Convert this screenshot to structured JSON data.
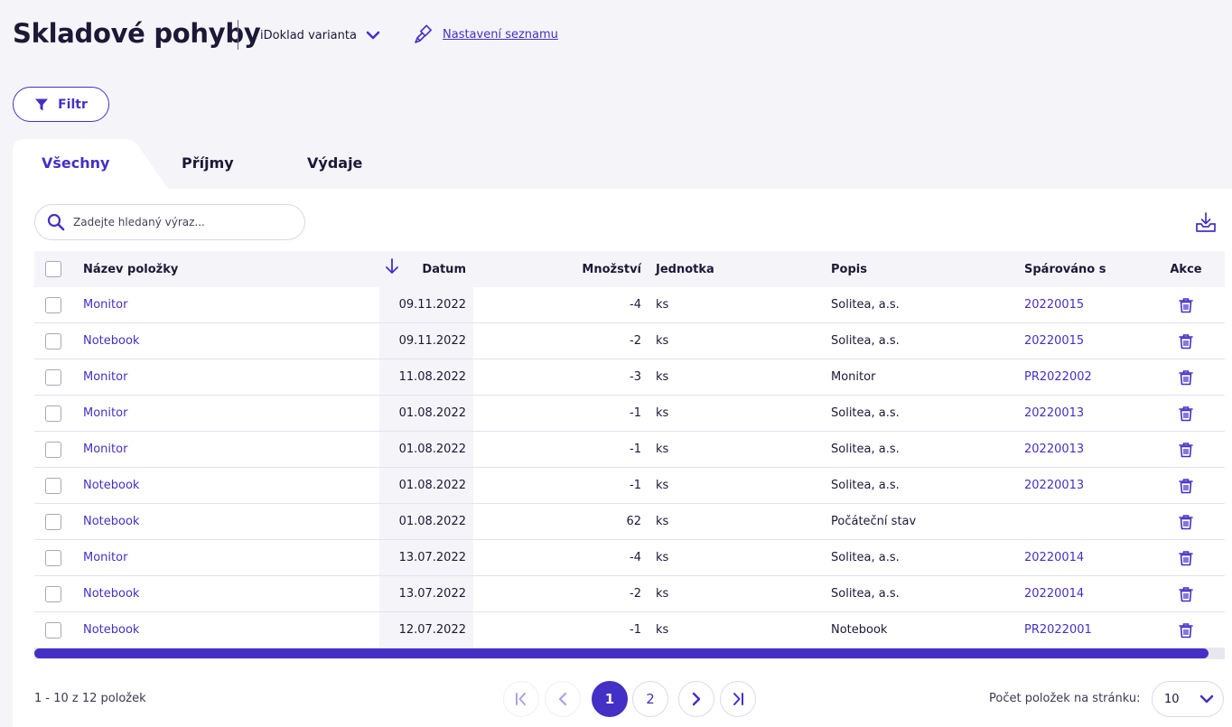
{
  "page": {
    "title": "Skladové pohyby"
  },
  "header": {
    "variant_label": "iDoklad varianta",
    "settings_link": "Nastavení seznamu"
  },
  "toolbar": {
    "filter_label": "Filtr"
  },
  "tabs": [
    {
      "label": "Všechny",
      "active": true
    },
    {
      "label": "Příjmy",
      "active": false
    },
    {
      "label": "Výdaje",
      "active": false
    }
  ],
  "search": {
    "placeholder": "Zadejte hledaný výraz..."
  },
  "table": {
    "columns": {
      "name": "Název položky",
      "date": "Datum",
      "qty": "Množství",
      "unit": "Jednotka",
      "desc": "Popis",
      "paired": "Spárováno s",
      "actions": "Akce"
    },
    "rows": [
      {
        "name": "Monitor",
        "date": "09.11.2022",
        "qty": "-4",
        "unit": "ks",
        "desc": "Solitea, a.s.",
        "paired": "20220015"
      },
      {
        "name": "Notebook",
        "date": "09.11.2022",
        "qty": "-2",
        "unit": "ks",
        "desc": "Solitea, a.s.",
        "paired": "20220015"
      },
      {
        "name": "Monitor",
        "date": "11.08.2022",
        "qty": "-3",
        "unit": "ks",
        "desc": "Monitor",
        "paired": "PR2022002"
      },
      {
        "name": "Monitor",
        "date": "01.08.2022",
        "qty": "-1",
        "unit": "ks",
        "desc": "Solitea, a.s.",
        "paired": "20220013"
      },
      {
        "name": "Monitor",
        "date": "01.08.2022",
        "qty": "-1",
        "unit": "ks",
        "desc": "Solitea, a.s.",
        "paired": "20220013"
      },
      {
        "name": "Notebook",
        "date": "01.08.2022",
        "qty": "-1",
        "unit": "ks",
        "desc": "Solitea, a.s.",
        "paired": "20220013"
      },
      {
        "name": "Notebook",
        "date": "01.08.2022",
        "qty": "62",
        "unit": "ks",
        "desc": "Počáteční stav",
        "paired": ""
      },
      {
        "name": "Monitor",
        "date": "13.07.2022",
        "qty": "-4",
        "unit": "ks",
        "desc": "Solitea, a.s.",
        "paired": "20220014"
      },
      {
        "name": "Notebook",
        "date": "13.07.2022",
        "qty": "-2",
        "unit": "ks",
        "desc": "Solitea, a.s.",
        "paired": "20220014"
      },
      {
        "name": "Notebook",
        "date": "12.07.2022",
        "qty": "-1",
        "unit": "ks",
        "desc": "Notebook",
        "paired": "PR2022001"
      }
    ]
  },
  "pagination": {
    "range_text": "1 - 10 z 12 položek",
    "pages": [
      "1",
      "2"
    ],
    "current_page": "1",
    "per_page_label": "Počet položek na stránku:",
    "per_page_value": "10"
  },
  "colors": {
    "accent": "#4430c5",
    "background": "#f5f4f9",
    "text": "#1b1936"
  },
  "icons": [
    "chevron-down-icon",
    "brush-icon",
    "filter-icon",
    "search-icon",
    "download-icon",
    "sort-arrow-down-icon",
    "trash-icon",
    "first-page-icon",
    "prev-page-icon",
    "next-page-icon",
    "last-page-icon"
  ]
}
